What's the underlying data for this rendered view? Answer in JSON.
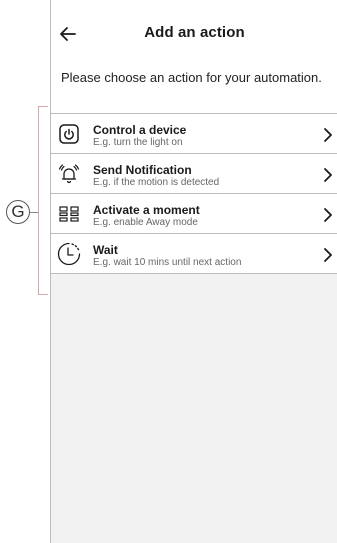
{
  "header": {
    "title": "Add an action"
  },
  "intro": "Please choose an action for your automation.",
  "actions": [
    {
      "title": "Control a device",
      "subtitle": "E.g. turn the light on",
      "icon": "power-button-icon"
    },
    {
      "title": "Send Notification",
      "subtitle": "E.g. if the motion is detected",
      "icon": "bell-notification-icon"
    },
    {
      "title": "Activate a moment",
      "subtitle": "E.g. enable Away mode",
      "icon": "grid-moment-icon"
    },
    {
      "title": "Wait",
      "subtitle": "E.g. wait 10 mins until next action",
      "icon": "clock-wait-icon"
    }
  ],
  "callout": {
    "label": "G"
  }
}
